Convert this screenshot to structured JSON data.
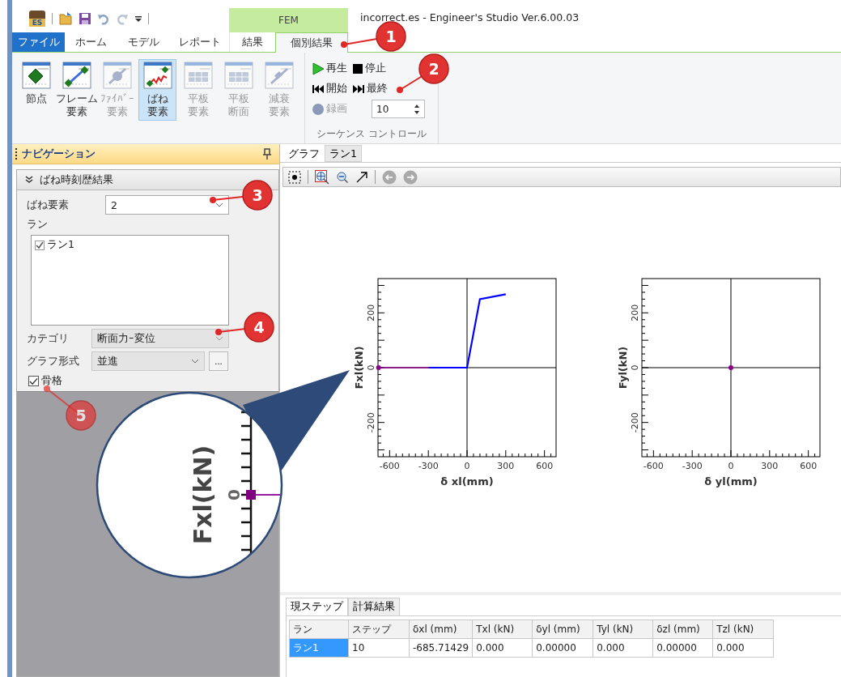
{
  "quick_access": {
    "logo": "ES"
  },
  "context_tab": "FEM",
  "title": "incorrect.es - Engineer's Studio Ver.6.00.03",
  "tabs": [
    {
      "label": "ファイル",
      "kind": "file",
      "selected": false
    },
    {
      "label": "ホーム",
      "kind": "normal",
      "selected": false
    },
    {
      "label": "モデル",
      "kind": "normal",
      "selected": false
    },
    {
      "label": "レポート",
      "kind": "normal",
      "selected": false
    },
    {
      "label": "結果",
      "kind": "context",
      "selected": false
    },
    {
      "label": "個別結果",
      "kind": "context",
      "selected": true
    }
  ],
  "ribbon_buttons": [
    {
      "kind": "node",
      "lines": [
        "節点"
      ],
      "disabled": false,
      "selected": false
    },
    {
      "kind": "frame",
      "lines": [
        "フレーム",
        "要素"
      ],
      "disabled": false,
      "selected": false
    },
    {
      "kind": "fiber",
      "lines": [
        "ﾌｧｲﾊﾞｰ",
        "要素"
      ],
      "disabled": true,
      "selected": false
    },
    {
      "kind": "spring",
      "lines": [
        "ばね",
        "要素"
      ],
      "disabled": false,
      "selected": true
    },
    {
      "kind": "plate",
      "lines": [
        "平板",
        "要素"
      ],
      "disabled": true,
      "selected": false
    },
    {
      "kind": "plate",
      "lines": [
        "平板",
        "断面"
      ],
      "disabled": true,
      "selected": false
    },
    {
      "kind": "damper",
      "lines": [
        "減衰",
        "要素"
      ],
      "disabled": true,
      "selected": false
    }
  ],
  "sequence_control": {
    "play": "再生",
    "stop": "停止",
    "first": "開始",
    "last": "最終",
    "record": {
      "label": "録画",
      "disabled": true
    },
    "step": "10",
    "group_label": "シーケンス コントロール"
  },
  "navigation": {
    "title": "ナビゲーション",
    "section": {
      "title": "ばね時刻歴結果",
      "expanded": true
    },
    "spring_element": {
      "label": "ばね要素",
      "value": "2"
    },
    "runs": {
      "label": "ラン",
      "items": [
        {
          "label": "ラン1",
          "checked": true
        }
      ]
    },
    "category": {
      "label": "カテゴリ",
      "value": "断面力ｰ変位",
      "disabled": true
    },
    "graph_format": {
      "label": "グラフ形式",
      "value": "並進",
      "button": "..."
    },
    "skeleton": {
      "label": "骨格",
      "checked": true
    }
  },
  "graph_tabs": [
    {
      "label": "グラフ",
      "selected": true
    },
    {
      "label": "ラン1",
      "selected": false
    }
  ],
  "charts": [
    {
      "chart_data": {
        "type": "line",
        "xlabel": "δ xl(mm)",
        "ylabel": "Fxl(kN)",
        "x": [
          -685.7,
          -300,
          0,
          100,
          300
        ],
        "xlim": [
          -690,
          690
        ],
        "ylim": [
          -325,
          325
        ],
        "xticks": [
          -600,
          -300,
          0,
          300,
          600
        ],
        "yticks": [
          -200,
          0,
          200
        ],
        "series": [
          {
            "color": "#8b008b",
            "marker": true,
            "values": [
              0,
              0,
              null,
              null,
              null
            ]
          },
          {
            "color": "#0000ff",
            "values": [
              null,
              0,
              0,
              250,
              268
            ]
          }
        ]
      }
    },
    {
      "chart_data": {
        "type": "line",
        "xlabel": "δ yl(mm)",
        "ylabel": "Fyl(kN)",
        "x": [
          0
        ],
        "xlim": [
          -690,
          690
        ],
        "ylim": [
          -325,
          325
        ],
        "xticks": [
          -600,
          -300,
          0,
          300,
          600
        ],
        "yticks": [
          -200,
          0,
          200
        ],
        "series": [
          {
            "color": "#8b008b",
            "marker": true,
            "values": [
              0
            ]
          }
        ]
      }
    }
  ],
  "bottom_tabs": [
    {
      "label": "現ステップ",
      "selected": true
    },
    {
      "label": "計算結果",
      "selected": false
    }
  ],
  "table": {
    "columns": [
      "ラン",
      "ステップ",
      "δxl (mm)",
      "Txl (kN)",
      "δyl (mm)",
      "Tyl (kN)",
      "δzl (mm)",
      "Tzl (kN)"
    ],
    "rows": [
      {
        "selected": true,
        "cells": [
          "ラン1",
          "10",
          "-685.71429",
          "0.000",
          "0.00000",
          "0.000",
          "0.00000",
          "0.000"
        ]
      }
    ]
  },
  "callouts": [
    {
      "label": "1",
      "faded": false
    },
    {
      "label": "2",
      "faded": false
    },
    {
      "label": "3",
      "faded": false
    },
    {
      "label": "4",
      "faded": false
    },
    {
      "label": "5",
      "faded": true
    }
  ],
  "magnifier": {
    "axis_title": "Fxl(kN)",
    "tick_label": "0"
  }
}
